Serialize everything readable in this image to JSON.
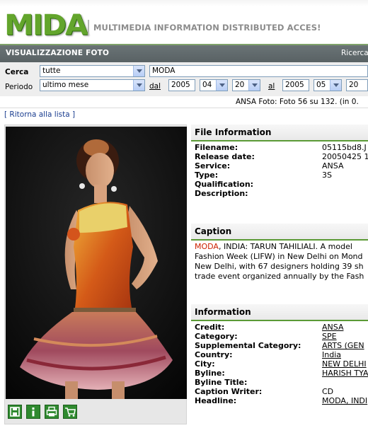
{
  "header": {
    "logo": "MIDA",
    "tagline": "MULTIMEDIA INFORMATION DISTRIBUTED ACCES!"
  },
  "titlebar": {
    "title": "VISUALIZZAZIONE FOTO",
    "right_link": "Ricerca"
  },
  "search": {
    "cerca_label": "Cerca",
    "cerca_select": "tutte",
    "query": "MODA",
    "periodo_label": "Periodo",
    "periodo_select": "ultimo mese",
    "dal_label": "dal",
    "dal_year": "2005",
    "dal_month": "04",
    "dal_day": "20",
    "al_label": "al",
    "al_year": "2005",
    "al_month": "05",
    "al_day": "20"
  },
  "status": "ANSA Foto: Foto 56 su 132. (in 0.",
  "back_link": "[ Ritorna alla lista ]",
  "file_info": {
    "heading": "File Information",
    "rows": [
      {
        "key": "Filename:",
        "value": "05115bd8.J"
      },
      {
        "key": "Release date:",
        "value": "20050425 1"
      },
      {
        "key": "Service:",
        "value": "ANSA"
      },
      {
        "key": "Type:",
        "value": "3S"
      },
      {
        "key": "Qualification:",
        "value": ""
      },
      {
        "key": "Description:",
        "value": ""
      }
    ]
  },
  "caption": {
    "heading": "Caption",
    "highlight": "MODA",
    "line1_rest": ", INDIA: TARUN TAHILIALI. A model",
    "line2": "Fashion Week (LIFW) in New Delhi on Mond",
    "line3": "New Delhi, with 67 designers holding 39 sh",
    "line4": "trade event organized annually by the Fash"
  },
  "information": {
    "heading": "Information",
    "rows": [
      {
        "key": "Credit:",
        "value": "ANSA",
        "link": true
      },
      {
        "key": "Category:",
        "value": "SPE",
        "link": true
      },
      {
        "key": "Supplemental Category:",
        "value": "ARTS (GEN",
        "link": true
      },
      {
        "key": "Country:",
        "value": "India",
        "link": true
      },
      {
        "key": "City:",
        "value": "NEW DELHI",
        "link": true
      },
      {
        "key": "Byline:",
        "value": "HARISH TYA",
        "link": true
      },
      {
        "key": "Byline Title:",
        "value": "",
        "link": false
      },
      {
        "key": "Caption Writer:",
        "value": "CD",
        "link": false
      },
      {
        "key": "Headline:",
        "value": "MODA, INDI",
        "link": true
      }
    ]
  },
  "toolbar": {
    "icons": [
      "save-icon",
      "info-icon",
      "print-icon",
      "cart-icon"
    ]
  }
}
